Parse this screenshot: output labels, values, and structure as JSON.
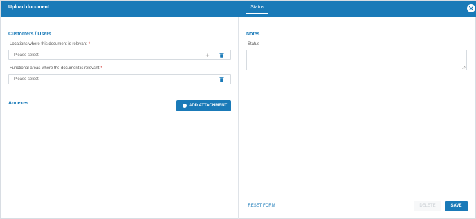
{
  "header": {
    "title": "Upload document",
    "tab_status": "Status",
    "close_icon": "close-icon"
  },
  "left": {
    "section_customers": "Customers / Users",
    "locations_label": "Locations where this document is relevant",
    "locations_placeholder": "Please select",
    "functional_label": "Functional areas where the document is relevant",
    "functional_placeholder": "Please select",
    "required_mark": "*",
    "add_symbol": "+",
    "section_annexes": "Annexes",
    "add_attachment_label": "ADD ATTACHMENT"
  },
  "right": {
    "section_notes": "Notes",
    "status_label": "Status",
    "status_value": ""
  },
  "footer": {
    "reset_label": "RESET FORM",
    "delete_label": "DELETE",
    "save_label": "SAVE"
  },
  "colors": {
    "accent": "#1a7ab8",
    "required": "#d0332e",
    "disabled_text": "#c9ced3"
  }
}
